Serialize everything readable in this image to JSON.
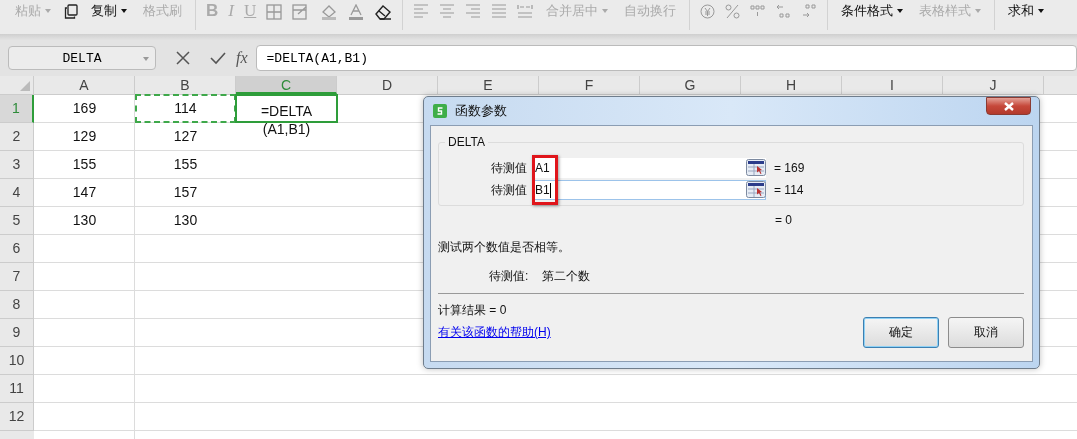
{
  "toolbar": [
    {
      "label": "粘贴",
      "disabled": true,
      "dropdown": true
    },
    {
      "label": "复制",
      "disabled": false,
      "dropdown": true
    },
    {
      "label": "格式刷",
      "disabled": true,
      "dropdown": false
    },
    {
      "label": "合并居中",
      "disabled": true,
      "dropdown": true
    },
    {
      "label": "自动换行",
      "disabled": true,
      "dropdown": false
    },
    {
      "label": "条件格式",
      "disabled": false,
      "dropdown": true
    },
    {
      "label": "表格样式",
      "disabled": true,
      "dropdown": true
    },
    {
      "label": "求和",
      "disabled": false,
      "dropdown": true
    }
  ],
  "format_buttons": [
    "B",
    "I",
    "U"
  ],
  "formula_bar": {
    "name_box": "DELTA",
    "fx": "fx",
    "formula": "=DELTA(A1,B1)"
  },
  "columns": [
    {
      "label": "A",
      "selected": false
    },
    {
      "label": "B",
      "selected": false
    },
    {
      "label": "C",
      "selected": true
    },
    {
      "label": "D",
      "selected": false
    },
    {
      "label": "E",
      "selected": false
    },
    {
      "label": "F",
      "selected": false
    },
    {
      "label": "G",
      "selected": false
    },
    {
      "label": "H",
      "selected": false
    },
    {
      "label": "I",
      "selected": false
    },
    {
      "label": "J",
      "selected": false
    }
  ],
  "rows": [
    {
      "label": "1",
      "selected": true,
      "cells": [
        {
          "text": "169",
          "selected": false,
          "copied": false
        },
        {
          "text": "114",
          "selected": false,
          "copied": true
        },
        {
          "text": "=DELTA(A1,B1)",
          "selected": true,
          "copied": false
        }
      ]
    },
    {
      "label": "2",
      "selected": false,
      "cells": [
        {
          "text": "129",
          "selected": false,
          "copied": false
        },
        {
          "text": "127",
          "selected": false,
          "copied": false
        }
      ]
    },
    {
      "label": "3",
      "selected": false,
      "cells": [
        {
          "text": "155",
          "selected": false,
          "copied": false
        },
        {
          "text": "155",
          "selected": false,
          "copied": false
        }
      ]
    },
    {
      "label": "4",
      "selected": false,
      "cells": [
        {
          "text": "147",
          "selected": false,
          "copied": false
        },
        {
          "text": "157",
          "selected": false,
          "copied": false
        }
      ]
    },
    {
      "label": "5",
      "selected": false,
      "cells": [
        {
          "text": "130",
          "selected": false,
          "copied": false
        },
        {
          "text": "130",
          "selected": false,
          "copied": false
        }
      ]
    },
    {
      "label": "6",
      "selected": false,
      "cells": []
    },
    {
      "label": "7",
      "selected": false,
      "cells": []
    },
    {
      "label": "8",
      "selected": false,
      "cells": []
    },
    {
      "label": "9",
      "selected": false,
      "cells": []
    },
    {
      "label": "10",
      "selected": false,
      "cells": []
    },
    {
      "label": "11",
      "selected": false,
      "cells": []
    },
    {
      "label": "12",
      "selected": false,
      "cells": []
    }
  ],
  "dialog": {
    "title": "函数参数",
    "function_name": "DELTA",
    "arguments": [
      {
        "label": "待测值",
        "value": "A1",
        "result": "= 169",
        "focused": false
      },
      {
        "label": "待测值",
        "value": "B1",
        "result": "= 114",
        "focused": true
      }
    ],
    "highlight_box": true,
    "formula_result": "= 0",
    "description": "测试两个数值是否相等。",
    "argument_label": "待测值:",
    "argument_help": "第二个数",
    "calculation": "计算结果 = 0",
    "help_link": "有关该函数的帮助(H)",
    "buttons": [
      {
        "label": "确定",
        "default": true
      },
      {
        "label": "取消",
        "default": false
      }
    ]
  }
}
